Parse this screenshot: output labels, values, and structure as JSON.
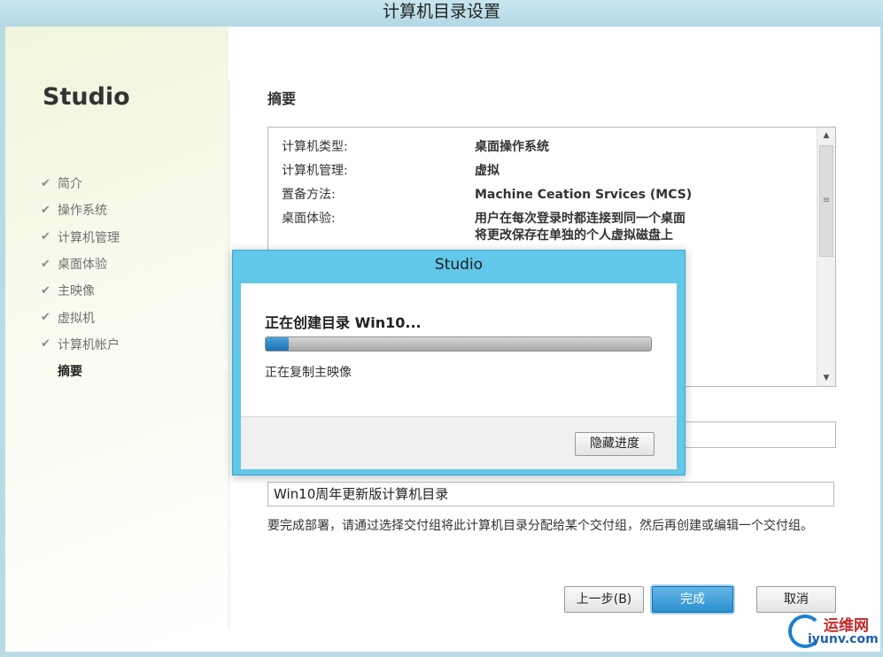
{
  "window": {
    "title": "计算机目录设置"
  },
  "sidebar": {
    "brand": "Studio",
    "steps": [
      {
        "label": "简介",
        "done": true
      },
      {
        "label": "操作系统",
        "done": true
      },
      {
        "label": "计算机管理",
        "done": true
      },
      {
        "label": "桌面体验",
        "done": true
      },
      {
        "label": "主映像",
        "done": true
      },
      {
        "label": "虚拟机",
        "done": true
      },
      {
        "label": "计算机帐户",
        "done": true
      },
      {
        "label": "摘要",
        "done": false,
        "current": true
      }
    ],
    "check_glyph": "✔"
  },
  "main": {
    "heading": "摘要",
    "summary": [
      {
        "key": "计算机类型:",
        "value": "桌面操作系统"
      },
      {
        "key": "计算机管理:",
        "value": "虚拟"
      },
      {
        "key": "置备方法:",
        "value": "Machine Ceation Srvices (MCS)"
      },
      {
        "key": "桌面体验:",
        "value": "用户在每次登录时都连接到同一个桌面",
        "value2": "将更改保存在单独的个人虚拟磁盘上"
      }
    ],
    "catalog_name_value": "Win10周年更新版计算机目录",
    "note": "要完成部署，请通过选择交付组将此计算机目录分配给某个交付组，然后再创建或编辑一个交付组。"
  },
  "buttons": {
    "back": "上一步(B)",
    "finish": "完成",
    "cancel": "取消"
  },
  "dialog": {
    "title": "Studio",
    "message": "正在创建目录 Win10...",
    "progress_percent": 6,
    "status": "正在复制主映像",
    "hide_button": "隐藏进度"
  },
  "watermark": {
    "cn": "运维网",
    "en": "iyunv.com"
  },
  "colors": {
    "accent": "#62c7e8",
    "progress": "#2b85c6"
  }
}
